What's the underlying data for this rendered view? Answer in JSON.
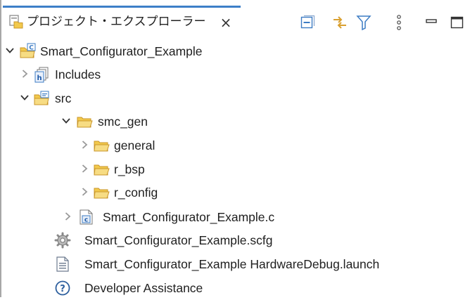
{
  "view": {
    "title": "プロジェクト・エクスプローラー",
    "close_glyph": "×",
    "toolbar": [
      {
        "icon": "collapse-all-icon"
      },
      {
        "icon": "link-with-editor-icon"
      },
      {
        "icon": "filter-icon"
      },
      {
        "icon": "view-menu-icon"
      },
      {
        "icon": "minimize-icon"
      },
      {
        "icon": "maximize-icon"
      }
    ]
  },
  "tree": {
    "rows": [
      {
        "label": "Smart_Configurator_Example",
        "icon": "c-project-icon",
        "toggle": "expanded"
      },
      {
        "label": "Includes",
        "icon": "includes-icon",
        "toggle": "collapsed"
      },
      {
        "label": "src",
        "icon": "source-folder-icon",
        "toggle": "expanded"
      },
      {
        "label": "smc_gen",
        "icon": "folder-icon",
        "toggle": "expanded"
      },
      {
        "label": "general",
        "icon": "folder-icon",
        "toggle": "collapsed"
      },
      {
        "label": "r_bsp",
        "icon": "folder-icon",
        "toggle": "collapsed"
      },
      {
        "label": "r_config",
        "icon": "folder-icon",
        "toggle": "collapsed"
      },
      {
        "label": "Smart_Configurator_Example.c",
        "icon": "c-file-icon",
        "toggle": "collapsed"
      },
      {
        "label": "Smart_Configurator_Example.scfg",
        "icon": "gear-file-icon",
        "toggle": "none"
      },
      {
        "label": "Smart_Configurator_Example HardwareDebug.launch",
        "icon": "launch-file-icon",
        "toggle": "none"
      },
      {
        "label": "Developer Assistance",
        "icon": "help-icon",
        "toggle": "none"
      }
    ]
  },
  "colors": {
    "accent": "#3d7fc8",
    "folder": "#f2c94c",
    "folder_edge": "#c9962a",
    "icon_blue": "#3c7cc4",
    "text": "#1f1f1f"
  }
}
